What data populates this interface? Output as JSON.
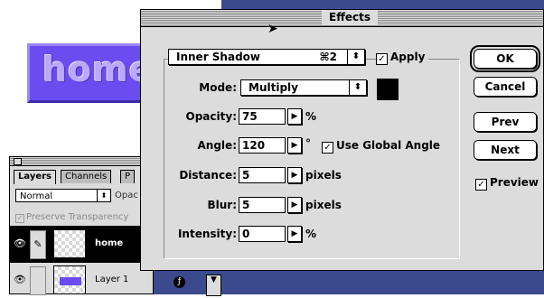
{
  "sample": {
    "text": "home"
  },
  "layers_palette": {
    "tabs": [
      "Layers",
      "Channels",
      "P"
    ],
    "blend_mode": "Normal",
    "opacity_label": "Opac",
    "preserve_transparency": "Preserve Transparency",
    "layers": [
      {
        "name": "home",
        "active": true
      },
      {
        "name": "Layer 1",
        "active": false
      }
    ]
  },
  "dialog": {
    "title": "Effects",
    "effect": {
      "value": "Inner Shadow",
      "shortcut": "⌘2"
    },
    "apply": {
      "label": "Apply",
      "checked": true
    },
    "mode": {
      "label": "Mode:",
      "value": "Multiply",
      "color": "#000000"
    },
    "opacity": {
      "label": "Opacity:",
      "value": "75",
      "unit": "%"
    },
    "angle": {
      "label": "Angle:",
      "value": "120",
      "unit": "°",
      "global_label": "Use Global Angle",
      "global_checked": true
    },
    "distance": {
      "label": "Distance:",
      "value": "5",
      "unit": "pixels"
    },
    "blur": {
      "label": "Blur:",
      "value": "5",
      "unit": "pixels"
    },
    "intensity": {
      "label": "Intensity:",
      "value": "0",
      "unit": "%"
    },
    "buttons": {
      "ok": "OK",
      "cancel": "Cancel",
      "prev": "Prev",
      "next": "Next"
    },
    "preview": {
      "label": "Preview",
      "checked": true
    }
  },
  "colors": {
    "accent_purple": "#6b4cf0",
    "desktop_blue": "#3a4a8c"
  }
}
